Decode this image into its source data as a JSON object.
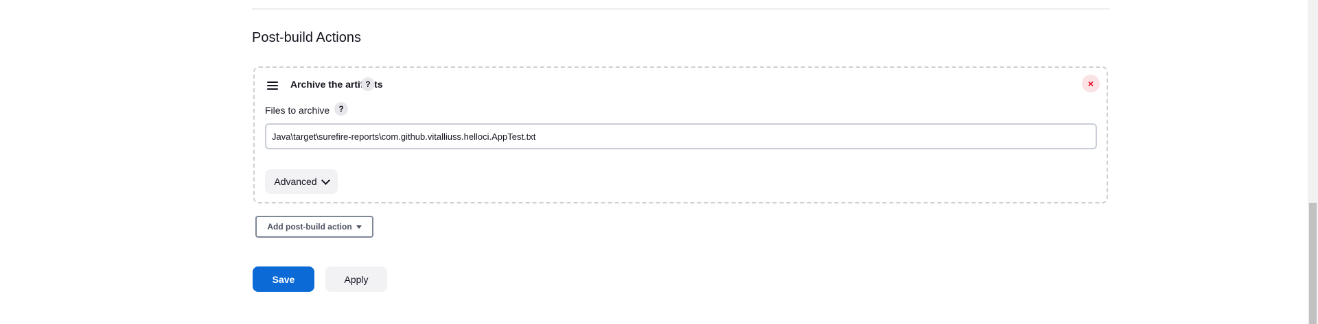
{
  "section": {
    "title": "Post-build Actions"
  },
  "step": {
    "title": "Archive the artifacts",
    "help_glyph": "?",
    "close_glyph": "×",
    "field": {
      "label": "Files to archive",
      "help_glyph": "?",
      "value": "Java\\target\\surefire-reports\\com.github.vitalliuss.helloci.AppTest.txt"
    },
    "advanced_label": "Advanced"
  },
  "add_action": {
    "label": "Add post-build action"
  },
  "footer": {
    "save_label": "Save",
    "apply_label": "Apply"
  },
  "colors": {
    "primary": "#0b6ad6",
    "danger": "#e6001f",
    "danger_bg": "#fbe3e5"
  }
}
